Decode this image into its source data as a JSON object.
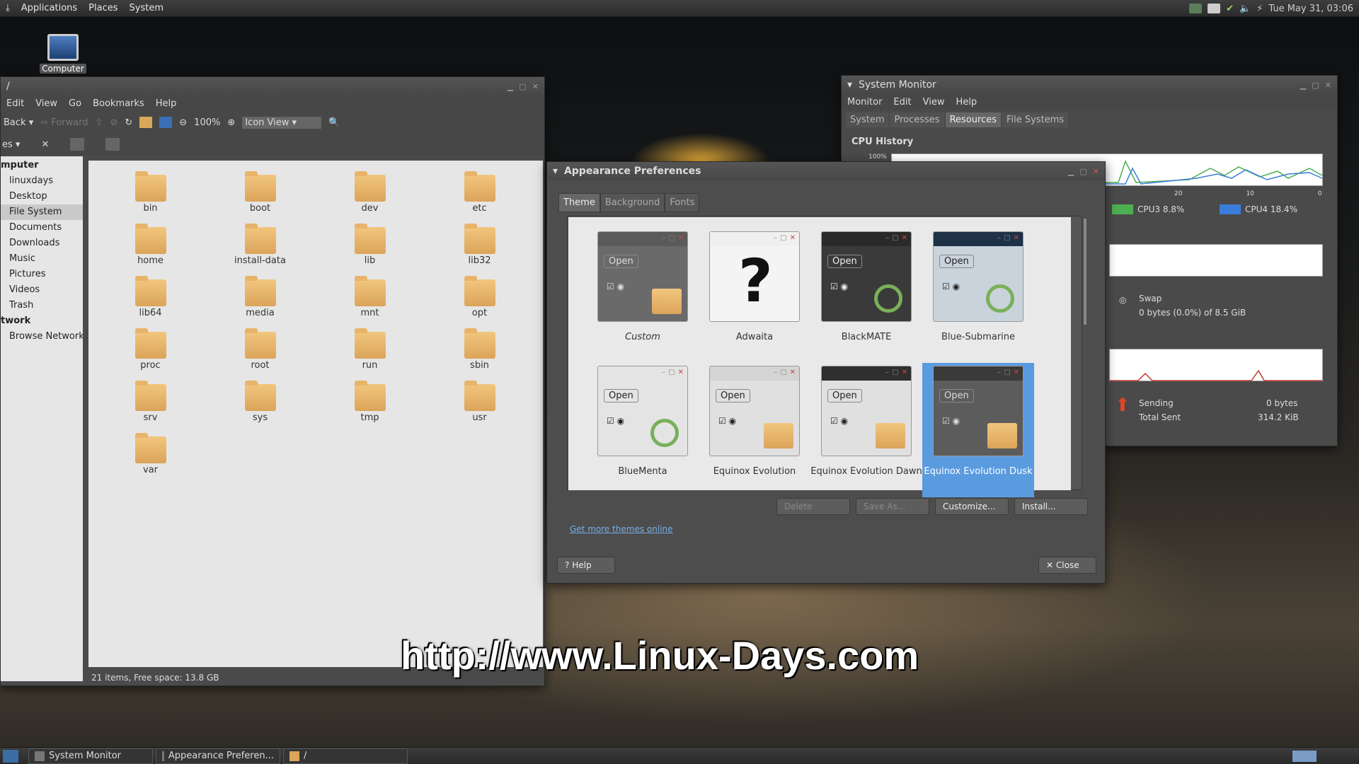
{
  "top_panel": {
    "menus": [
      "Applications",
      "Places",
      "System"
    ],
    "clock": "Tue May 31, 03:06"
  },
  "desktop": {
    "computer_label": "Computer"
  },
  "file_manager": {
    "title": "/",
    "menus": [
      "Edit",
      "View",
      "Go",
      "Bookmarks",
      "Help"
    ],
    "toolbar": {
      "back": "Back",
      "forward": "Forward",
      "zoom": "100%",
      "view_mode": "Icon View"
    },
    "sidebar_heading": "es",
    "places": [
      {
        "label": "mputer",
        "heading": true
      },
      {
        "label": "linuxdays"
      },
      {
        "label": "Desktop"
      },
      {
        "label": "File System",
        "selected": true
      },
      {
        "label": "Documents"
      },
      {
        "label": "Downloads"
      },
      {
        "label": "Music"
      },
      {
        "label": "Pictures"
      },
      {
        "label": "Videos"
      },
      {
        "label": "Trash"
      },
      {
        "label": "twork",
        "heading": true
      },
      {
        "label": "Browse Network"
      }
    ],
    "folders": [
      "bin",
      "boot",
      "dev",
      "etc",
      "home",
      "install-data",
      "lib",
      "lib32",
      "lib64",
      "media",
      "mnt",
      "opt",
      "proc",
      "root",
      "run",
      "sbin",
      "srv",
      "sys",
      "tmp",
      "usr",
      "var"
    ],
    "status": "21 items, Free space: 13.8 GB"
  },
  "system_monitor": {
    "title": "System Monitor",
    "menus": [
      "Monitor",
      "Edit",
      "View",
      "Help"
    ],
    "tabs": [
      "System",
      "Processes",
      "Resources",
      "File Systems"
    ],
    "cpu_heading": "CPU History",
    "cpu_100": "100%",
    "cpu3": "CPU3  8.8%",
    "cpu4": "CPU4  18.4%",
    "cpu3_color": "#4caf50",
    "cpu4_color": "#3b7ddd",
    "swap_label": "Swap",
    "swap_value": "0 bytes (0.0%) of 8.5 GiB",
    "sending": "Sending",
    "sending_val": "0 bytes",
    "total_sent": "Total Sent",
    "total_sent_val": "314.2 KiB",
    "axis_ticks": [
      "20",
      "10",
      "0"
    ]
  },
  "appearance": {
    "title": "Appearance Preferences",
    "tabs": [
      "Theme",
      "Background",
      "Fonts"
    ],
    "open_label": "Open",
    "themes": [
      {
        "name": "Custom",
        "bg": "#6a6a6a",
        "bar": "#5a5a5a",
        "fg": "#ddd",
        "italic": true,
        "icon": "folder"
      },
      {
        "name": "Adwaita",
        "bg": "#f4f4f4",
        "bar": "#f0f0f0",
        "fg": "#ccc",
        "icon": "question"
      },
      {
        "name": "BlackMATE",
        "bg": "#3a3a3a",
        "bar": "#2a2a2a",
        "fg": "#eee",
        "icon": "ring"
      },
      {
        "name": "Blue-Submarine",
        "bg": "#c9d3dc",
        "bar": "#1e3146",
        "fg": "#222",
        "icon": "ring"
      },
      {
        "name": "BlueMenta",
        "bg": "#e4e4e4",
        "bar": "#e4e4e4",
        "fg": "#222",
        "icon": "ring"
      },
      {
        "name": "Equinox Evolution",
        "bg": "#e0e0e0",
        "bar": "#d4d4d4",
        "fg": "#222",
        "icon": "folder"
      },
      {
        "name": "Equinox Evolution Dawn",
        "bg": "#e0e0e0",
        "bar": "#2f2f2f",
        "fg": "#222",
        "icon": "folder"
      },
      {
        "name": "Equinox Evolution Dusk",
        "bg": "#5c5c5c",
        "bar": "#3a3a3a",
        "fg": "#ddd",
        "icon": "folder",
        "selected": true
      }
    ],
    "buttons": {
      "delete": "Delete",
      "save_as": "Save As...",
      "customize": "Customize...",
      "install": "Install..."
    },
    "more_link": "Get more themes online",
    "help": "Help",
    "close": "Close"
  },
  "watermark": "http://www.Linux-Days.com",
  "taskbar": [
    {
      "label": "System Monitor"
    },
    {
      "label": "Appearance Preferen..."
    },
    {
      "label": "/"
    }
  ]
}
